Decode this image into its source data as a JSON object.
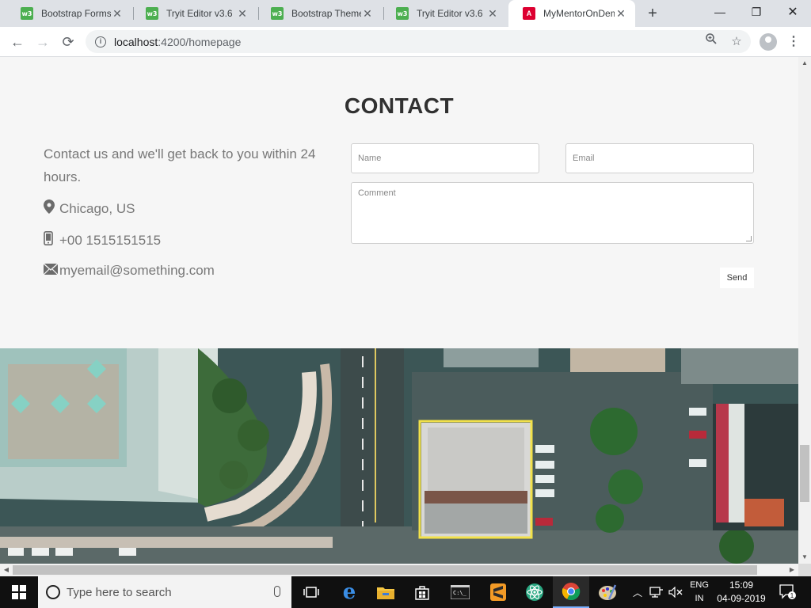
{
  "browser": {
    "tabs": [
      {
        "label": "Bootstrap Forms",
        "favicon": "w3schools-icon",
        "active": false
      },
      {
        "label": "Tryit Editor v3.6",
        "favicon": "w3schools-icon",
        "active": false
      },
      {
        "label": "Bootstrap Theme",
        "favicon": "w3schools-icon",
        "active": false
      },
      {
        "label": "Tryit Editor v3.6",
        "favicon": "w3schools-icon",
        "active": false
      },
      {
        "label": "MyMentorOnDem",
        "favicon": "angular-icon",
        "active": true
      }
    ],
    "new_tab_glyph": "+",
    "url_host": "localhost",
    "url_path": ":4200/homepage"
  },
  "contact": {
    "title": "CONTACT",
    "intro": "Contact us and we'll get back to you within 24 hours.",
    "location": "Chicago, US",
    "phone": "+00 1515151515",
    "email": "myemail@something.com",
    "form": {
      "name_placeholder": "Name",
      "email_placeholder": "Email",
      "comment_placeholder": "Comment",
      "send_label": "Send"
    }
  },
  "taskbar": {
    "search_placeholder": "Type here to search",
    "lang_top": "ENG",
    "lang_bottom": "IN",
    "time": "15:09",
    "date": "04-09-2019",
    "notification_count": "1"
  },
  "colors": {
    "page_bg": "#f6f6f6",
    "taskbar_bg": "#101010",
    "tab_strip_bg": "#dee1e6"
  }
}
